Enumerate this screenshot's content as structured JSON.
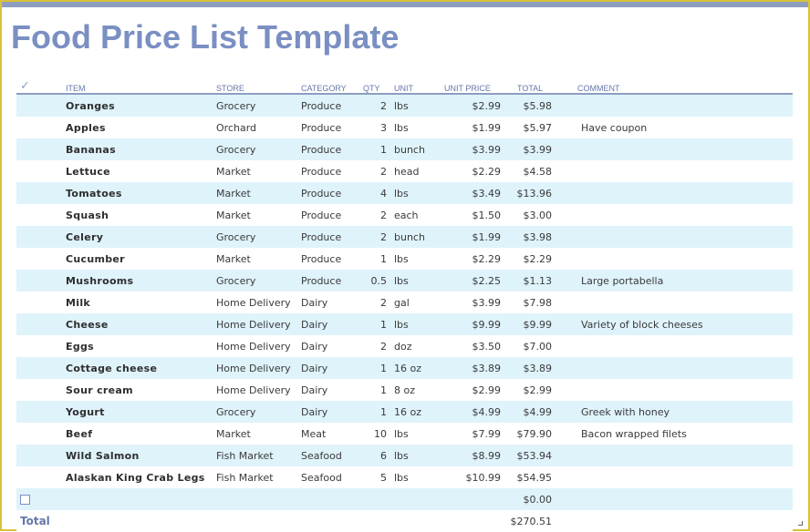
{
  "title": "Food Price List Template",
  "columns": {
    "check": "✓",
    "item": "ITEM",
    "store": "STORE",
    "category": "CATEGORY",
    "qty": "QTY",
    "unit": "UNIT",
    "unit_price": "UNIT PRICE",
    "total": "TOTAL",
    "comment": "COMMENT"
  },
  "rows": [
    {
      "item": "Oranges",
      "store": "Grocery",
      "category": "Produce",
      "qty": "2",
      "unit": "lbs",
      "unit_price": "$2.99",
      "total": "$5.98",
      "comment": ""
    },
    {
      "item": "Apples",
      "store": "Orchard",
      "category": "Produce",
      "qty": "3",
      "unit": "lbs",
      "unit_price": "$1.99",
      "total": "$5.97",
      "comment": "Have coupon"
    },
    {
      "item": "Bananas",
      "store": "Grocery",
      "category": "Produce",
      "qty": "1",
      "unit": "bunch",
      "unit_price": "$3.99",
      "total": "$3.99",
      "comment": ""
    },
    {
      "item": "Lettuce",
      "store": "Market",
      "category": "Produce",
      "qty": "2",
      "unit": "head",
      "unit_price": "$2.29",
      "total": "$4.58",
      "comment": ""
    },
    {
      "item": "Tomatoes",
      "store": "Market",
      "category": "Produce",
      "qty": "4",
      "unit": "lbs",
      "unit_price": "$3.49",
      "total": "$13.96",
      "comment": ""
    },
    {
      "item": "Squash",
      "store": "Market",
      "category": "Produce",
      "qty": "2",
      "unit": "each",
      "unit_price": "$1.50",
      "total": "$3.00",
      "comment": ""
    },
    {
      "item": "Celery",
      "store": "Grocery",
      "category": "Produce",
      "qty": "2",
      "unit": "bunch",
      "unit_price": "$1.99",
      "total": "$3.98",
      "comment": ""
    },
    {
      "item": "Cucumber",
      "store": "Market",
      "category": "Produce",
      "qty": "1",
      "unit": "lbs",
      "unit_price": "$2.29",
      "total": "$2.29",
      "comment": ""
    },
    {
      "item": "Mushrooms",
      "store": "Grocery",
      "category": "Produce",
      "qty": "0.5",
      "unit": "lbs",
      "unit_price": "$2.25",
      "total": "$1.13",
      "comment": "Large portabella"
    },
    {
      "item": "Milk",
      "store": "Home Delivery",
      "category": "Dairy",
      "qty": "2",
      "unit": "gal",
      "unit_price": "$3.99",
      "total": "$7.98",
      "comment": ""
    },
    {
      "item": "Cheese",
      "store": "Home Delivery",
      "category": "Dairy",
      "qty": "1",
      "unit": "lbs",
      "unit_price": "$9.99",
      "total": "$9.99",
      "comment": "Variety of block cheeses"
    },
    {
      "item": "Eggs",
      "store": "Home Delivery",
      "category": "Dairy",
      "qty": "2",
      "unit": "doz",
      "unit_price": "$3.50",
      "total": "$7.00",
      "comment": ""
    },
    {
      "item": "Cottage cheese",
      "store": "Home Delivery",
      "category": "Dairy",
      "qty": "1",
      "unit": "16 oz",
      "unit_price": "$3.89",
      "total": "$3.89",
      "comment": ""
    },
    {
      "item": "Sour cream",
      "store": "Home Delivery",
      "category": "Dairy",
      "qty": "1",
      "unit": "8 oz",
      "unit_price": "$2.99",
      "total": "$2.99",
      "comment": ""
    },
    {
      "item": "Yogurt",
      "store": "Grocery",
      "category": "Dairy",
      "qty": "1",
      "unit": "16 oz",
      "unit_price": "$4.99",
      "total": "$4.99",
      "comment": "Greek with honey"
    },
    {
      "item": "Beef",
      "store": "Market",
      "category": "Meat",
      "qty": "10",
      "unit": "lbs",
      "unit_price": "$7.99",
      "total": "$79.90",
      "comment": "Bacon wrapped filets"
    },
    {
      "item": "Wild Salmon",
      "store": "Fish Market",
      "category": "Seafood",
      "qty": "6",
      "unit": "lbs",
      "unit_price": "$8.99",
      "total": "$53.94",
      "comment": ""
    },
    {
      "item": "Alaskan King Crab Legs",
      "store": "Fish Market",
      "category": "Seafood",
      "qty": "5",
      "unit": "lbs",
      "unit_price": "$10.99",
      "total": "$54.95",
      "comment": ""
    }
  ],
  "empty_row": {
    "total": "$0.00"
  },
  "footer": {
    "label": "Total",
    "total": "$270.51"
  },
  "colors": {
    "accent": "#7a8fc2",
    "band": "#dff3fb",
    "border": "#d9c23a"
  },
  "icons": {
    "check_header": "checkmark-icon",
    "row_checkbox": "checkbox-icon"
  }
}
